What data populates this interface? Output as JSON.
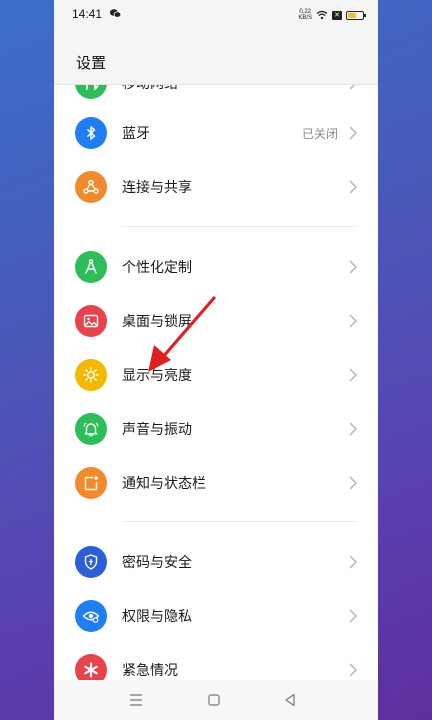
{
  "status_bar": {
    "time": "14:41",
    "net_speed_top": "0.22",
    "net_speed_bottom": "KB/S",
    "sim_badge": "✕",
    "battery_level_percent": 60,
    "battery_color": "#e8c32c"
  },
  "header": {
    "title": "设置"
  },
  "partial_item": {
    "label": "移动网络",
    "icon": "mobile-network-icon",
    "color": "#2ebd59"
  },
  "items": [
    {
      "id": "bluetooth",
      "label": "蓝牙",
      "value": "已关闭",
      "icon": "bluetooth-icon",
      "color": "#1e7ef2"
    },
    {
      "id": "connection-sharing",
      "label": "连接与共享",
      "icon": "share-icon",
      "color": "#f08a2c"
    },
    {
      "id": "personalization",
      "label": "个性化定制",
      "icon": "compass-icon",
      "color": "#2ebd59"
    },
    {
      "id": "desktop-lockscreen",
      "label": "桌面与锁屏",
      "icon": "image-icon",
      "color": "#e8434a"
    },
    {
      "id": "display-brightness",
      "label": "显示与亮度",
      "icon": "sun-icon",
      "color": "#f5b800"
    },
    {
      "id": "sound-vibration",
      "label": "声音与振动",
      "icon": "bell-icon",
      "color": "#2ebd59"
    },
    {
      "id": "notification-statusbar",
      "label": "通知与状态栏",
      "icon": "notification-icon",
      "color": "#f08a2c"
    },
    {
      "id": "password-security",
      "label": "密码与安全",
      "icon": "shield-icon",
      "color": "#2a5fd8"
    },
    {
      "id": "permission-privacy",
      "label": "权限与隐私",
      "icon": "eye-icon",
      "color": "#1e7ef2"
    },
    {
      "id": "emergency",
      "label": "紧急情况",
      "icon": "asterisk-icon",
      "color": "#e8434a"
    }
  ],
  "annotation": {
    "arrow_color": "#e02020"
  },
  "nav": {
    "menu": "menu-icon",
    "home": "home-icon",
    "back": "back-icon"
  }
}
